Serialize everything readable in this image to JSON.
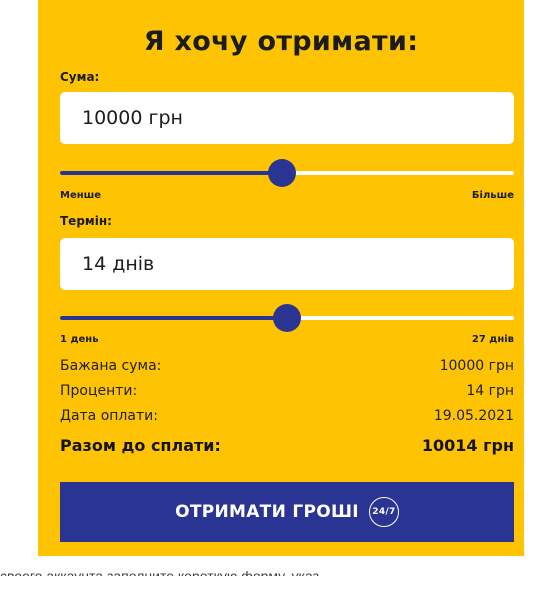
{
  "form": {
    "title": "Я хочу отримати:",
    "amount": {
      "label": "Сума:",
      "value": "10000 грн",
      "slider_fraction": 0.49,
      "min_label": "Менше",
      "max_label": "Більше"
    },
    "term": {
      "label": "Термін:",
      "value": "14 днів",
      "slider_fraction": 0.5,
      "min_label": "1 день",
      "max_label": "27 днів"
    },
    "summary": [
      {
        "label": "Бажана сума:",
        "value": "10000 грн"
      },
      {
        "label": "Проценти:",
        "value": "14 грн"
      },
      {
        "label": "Дата оплати:",
        "value": "19.05.2021"
      }
    ],
    "total": {
      "label": "Разом до сплати:",
      "value": "10014 грн"
    },
    "submit": {
      "label": "ОТРИМАТИ ГРОШІ",
      "badge": "24/7"
    }
  },
  "footer_text": "своего аккаунта заполните короткую форму, указ",
  "colors": {
    "card": "#fec302",
    "accent": "#2a3593",
    "white": "#ffffff"
  }
}
